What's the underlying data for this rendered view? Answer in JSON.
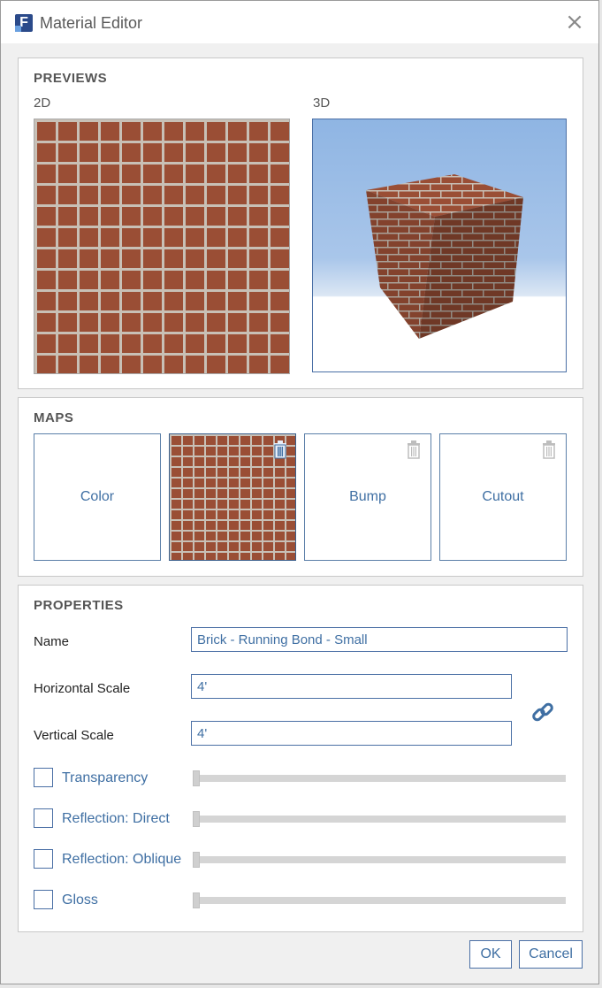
{
  "window": {
    "title": "Material Editor",
    "app_icon_letter": "F"
  },
  "previews": {
    "heading": "PREVIEWS",
    "label_2d": "2D",
    "label_3d": "3D"
  },
  "maps": {
    "heading": "MAPS",
    "tiles": [
      {
        "label": "Color",
        "has_image": false
      },
      {
        "label": "",
        "has_image": true
      },
      {
        "label": "Bump",
        "has_image": false
      },
      {
        "label": "Cutout",
        "has_image": false
      }
    ]
  },
  "properties": {
    "heading": "PROPERTIES",
    "name_label": "Name",
    "name_value": "Brick - Running Bond - Small",
    "hscale_label": "Horizontal Scale",
    "hscale_value": "4'",
    "vscale_label": "Vertical Scale",
    "vscale_value": "4'",
    "options": [
      {
        "label": "Transparency",
        "checked": false,
        "value": 0
      },
      {
        "label": "Reflection: Direct",
        "checked": false,
        "value": 0
      },
      {
        "label": "Reflection: Oblique",
        "checked": false,
        "value": 0
      },
      {
        "label": "Gloss",
        "checked": false,
        "value": 0
      }
    ]
  },
  "buttons": {
    "ok": "OK",
    "cancel": "Cancel"
  },
  "colors": {
    "accent": "#3f6fa3",
    "border_accent": "#4a6fa5",
    "brick": "#9a4e35",
    "mortar": "#c8c0b6"
  }
}
